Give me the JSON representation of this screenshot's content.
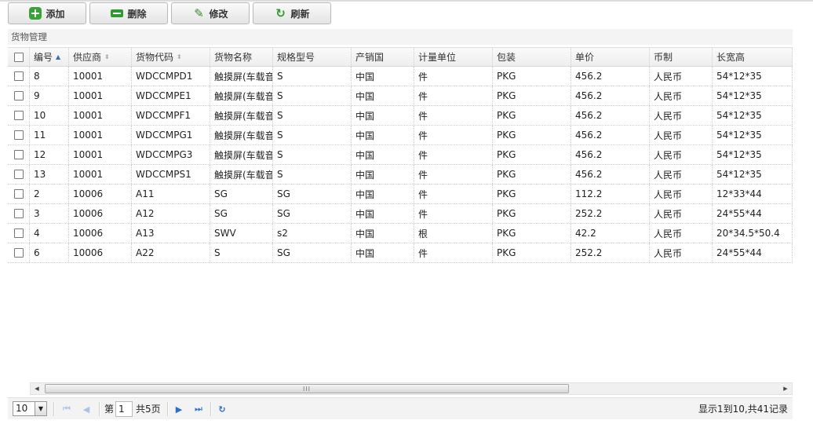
{
  "toolbar": {
    "add_label": "添加",
    "delete_label": "删除",
    "edit_label": "修改",
    "refresh_label": "刷新"
  },
  "panel": {
    "title": "货物管理"
  },
  "grid": {
    "columns": [
      {
        "label": "编号",
        "sort": "asc"
      },
      {
        "label": "供应商",
        "sort": "both"
      },
      {
        "label": "货物代码",
        "sort": "both"
      },
      {
        "label": "货物名称",
        "sort": ""
      },
      {
        "label": "规格型号",
        "sort": ""
      },
      {
        "label": "产销国",
        "sort": ""
      },
      {
        "label": "计量单位",
        "sort": ""
      },
      {
        "label": "包装",
        "sort": ""
      },
      {
        "label": "单价",
        "sort": ""
      },
      {
        "label": "币制",
        "sort": ""
      },
      {
        "label": "长宽高",
        "sort": ""
      }
    ],
    "rows": [
      [
        "8",
        "10001",
        "WDCCMPD1",
        "触摸屏(车载音",
        "S",
        "中国",
        "件",
        "PKG",
        "456.2",
        "人民币",
        "54*12*35"
      ],
      [
        "9",
        "10001",
        "WDCCMPE1",
        "触摸屏(车载音",
        "S",
        "中国",
        "件",
        "PKG",
        "456.2",
        "人民币",
        "54*12*35"
      ],
      [
        "10",
        "10001",
        "WDCCMPF1",
        "触摸屏(车载音",
        "S",
        "中国",
        "件",
        "PKG",
        "456.2",
        "人民币",
        "54*12*35"
      ],
      [
        "11",
        "10001",
        "WDCCMPG1",
        "触摸屏(车载音",
        "S",
        "中国",
        "件",
        "PKG",
        "456.2",
        "人民币",
        "54*12*35"
      ],
      [
        "12",
        "10001",
        "WDCCMPG3",
        "触摸屏(车载音",
        "S",
        "中国",
        "件",
        "PKG",
        "456.2",
        "人民币",
        "54*12*35"
      ],
      [
        "13",
        "10001",
        "WDCCMPS1",
        "触摸屏(车载音",
        "S",
        "中国",
        "件",
        "PKG",
        "456.2",
        "人民币",
        "54*12*35"
      ],
      [
        "2",
        "10006",
        "A11",
        "SG",
        "SG",
        "中国",
        "件",
        "PKG",
        "112.2",
        "人民币",
        "12*33*44"
      ],
      [
        "3",
        "10006",
        "A12",
        "SG",
        "SG",
        "中国",
        "件",
        "PKG",
        "252.2",
        "人民币",
        "24*55*44"
      ],
      [
        "4",
        "10006",
        "A13",
        "SWV",
        "s2",
        "中国",
        "根",
        "PKG",
        "42.2",
        "人民币",
        "20*34.5*50.4"
      ],
      [
        "6",
        "10006",
        "A22",
        "S",
        "SG",
        "中国",
        "件",
        "PKG",
        "252.2",
        "人民币",
        "24*55*44"
      ]
    ]
  },
  "pager": {
    "page_size": "10",
    "page_prefix": "第",
    "page_value": "1",
    "total_pages": "共5页",
    "info": "显示1到10,共41记录"
  }
}
